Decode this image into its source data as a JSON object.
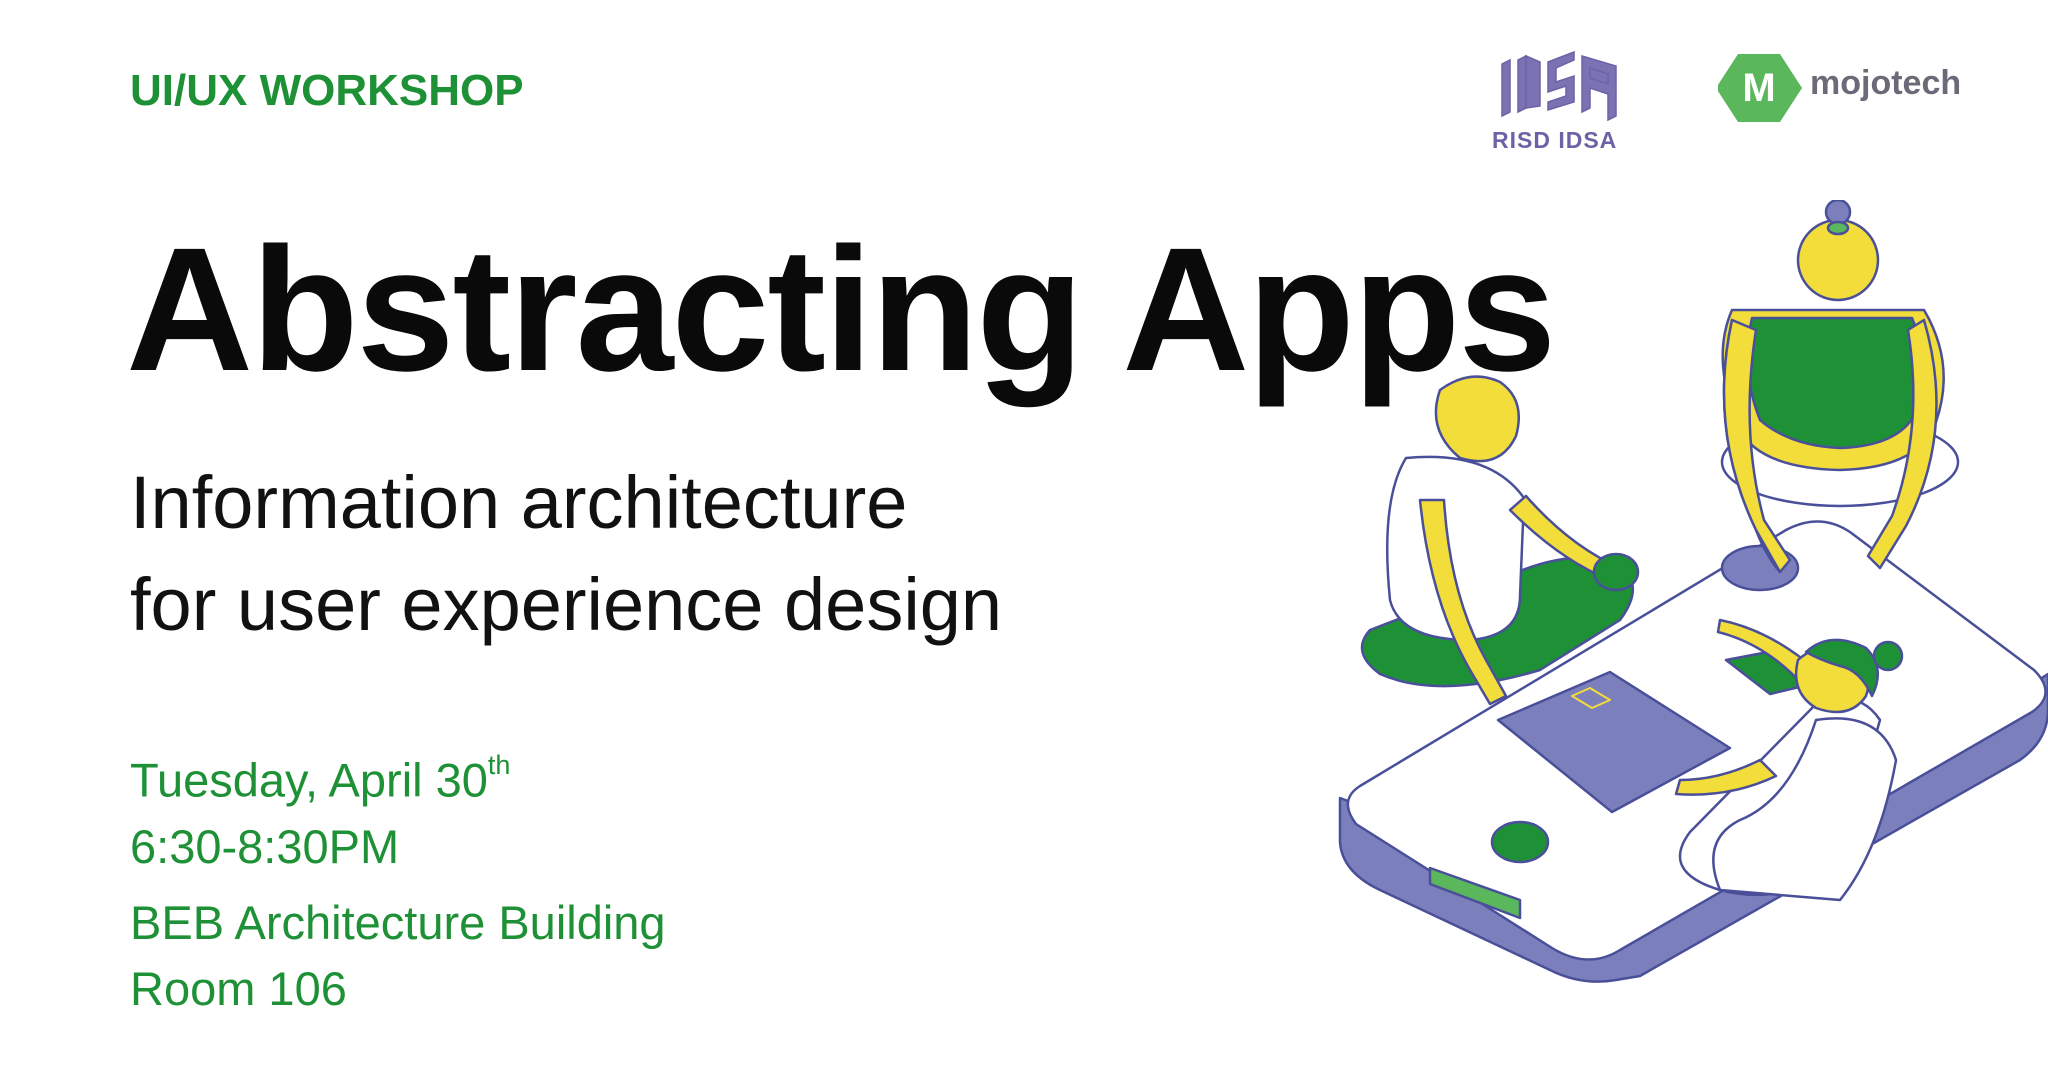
{
  "event": {
    "eyebrow": "UI/UX WORKSHOP",
    "title": "Abstracting Apps",
    "subtitle_line1": "Information architecture",
    "subtitle_line2": "for user experience design",
    "date_main": "Tuesday, April 30",
    "date_suffix": "th",
    "time": "6:30-8:30PM",
    "venue": "BEB Architecture Building",
    "room": "Room 106"
  },
  "logos": {
    "risd_label": "RISD IDSA",
    "mojo_label": "mojotech",
    "mojo_mark": "M"
  },
  "colors": {
    "accent_green": "#1e9136",
    "title_black": "#0a0a0a",
    "logo_purple": "#6c63a6",
    "illustration_yellow": "#f2dd3a",
    "illustration_periwinkle": "#7b80bd",
    "illustration_green": "#1e9136"
  }
}
